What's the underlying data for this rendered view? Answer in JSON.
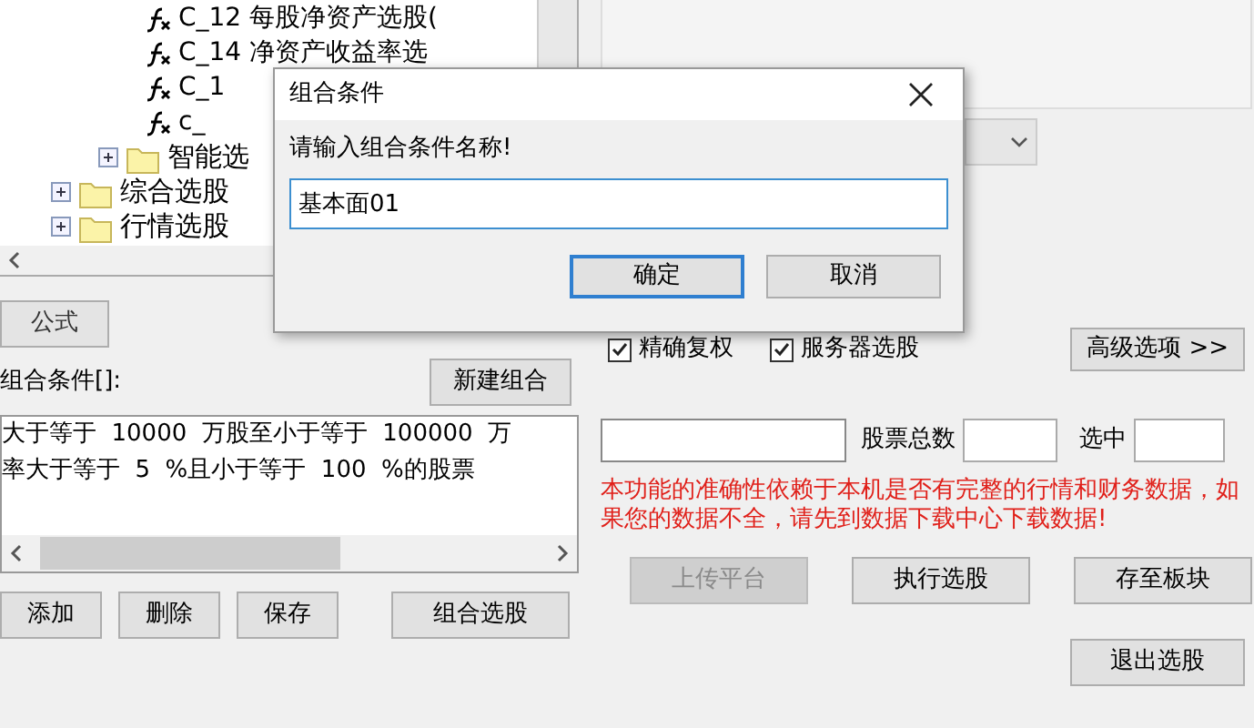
{
  "tree": {
    "items": [
      {
        "kind": "group",
        "children": [
          {
            "kind": "group",
            "children": [
              {
                "kind": "formula",
                "label": "C_12 每股净资产选股("
              },
              {
                "kind": "formula",
                "label": "C_14 净资产收益率选"
              },
              {
                "kind": "formula",
                "label": "C_1"
              },
              {
                "kind": "formula",
                "label": "c_"
              }
            ]
          },
          {
            "kind": "folder",
            "label": "智能选",
            "expanded": false
          }
        ]
      },
      {
        "kind": "folder",
        "label": "综合选股",
        "expanded": false
      },
      {
        "kind": "folder",
        "label": "行情选股",
        "expanded": false
      }
    ]
  },
  "tabs": [
    {
      "label": "公式",
      "selected": true
    }
  ],
  "conditions": {
    "label": "组合条件[]:",
    "new_button": "新建组合",
    "rows": [
      {
        "text": "大于等于  10000  万股至小于等于  100000  万"
      },
      {
        "text": "率大于等于  5  %且小于等于  100  %的股票"
      }
    ]
  },
  "left_buttons": [
    {
      "label": "添加"
    },
    {
      "label": "删除"
    },
    {
      "label": "保存"
    },
    {
      "label": "组合选股"
    }
  ],
  "options": [
    {
      "label": "精确复权",
      "checked": true
    },
    {
      "label": "服务器选股",
      "checked": true
    }
  ],
  "advanced_button": "高级选项 >>",
  "counts": {
    "total_label": "股票总数",
    "selected_label": "选中"
  },
  "warning": "本功能的准确性依赖于本机是否有完整的行情和财务数据，如果您的数据不全，请先到数据下载中心下载数据!",
  "right_buttons": [
    {
      "label": "上传平台",
      "disabled": true
    },
    {
      "label": "执行选股",
      "disabled": false
    },
    {
      "label": "存至板块",
      "disabled": false
    }
  ],
  "exit_button": "退出选股",
  "dialog": {
    "title": "组合条件",
    "prompt": "请输入组合条件名称!",
    "value": "基本面01",
    "buttons": [
      {
        "label": "确定",
        "default": true
      },
      {
        "label": "取消",
        "default": false
      }
    ]
  }
}
